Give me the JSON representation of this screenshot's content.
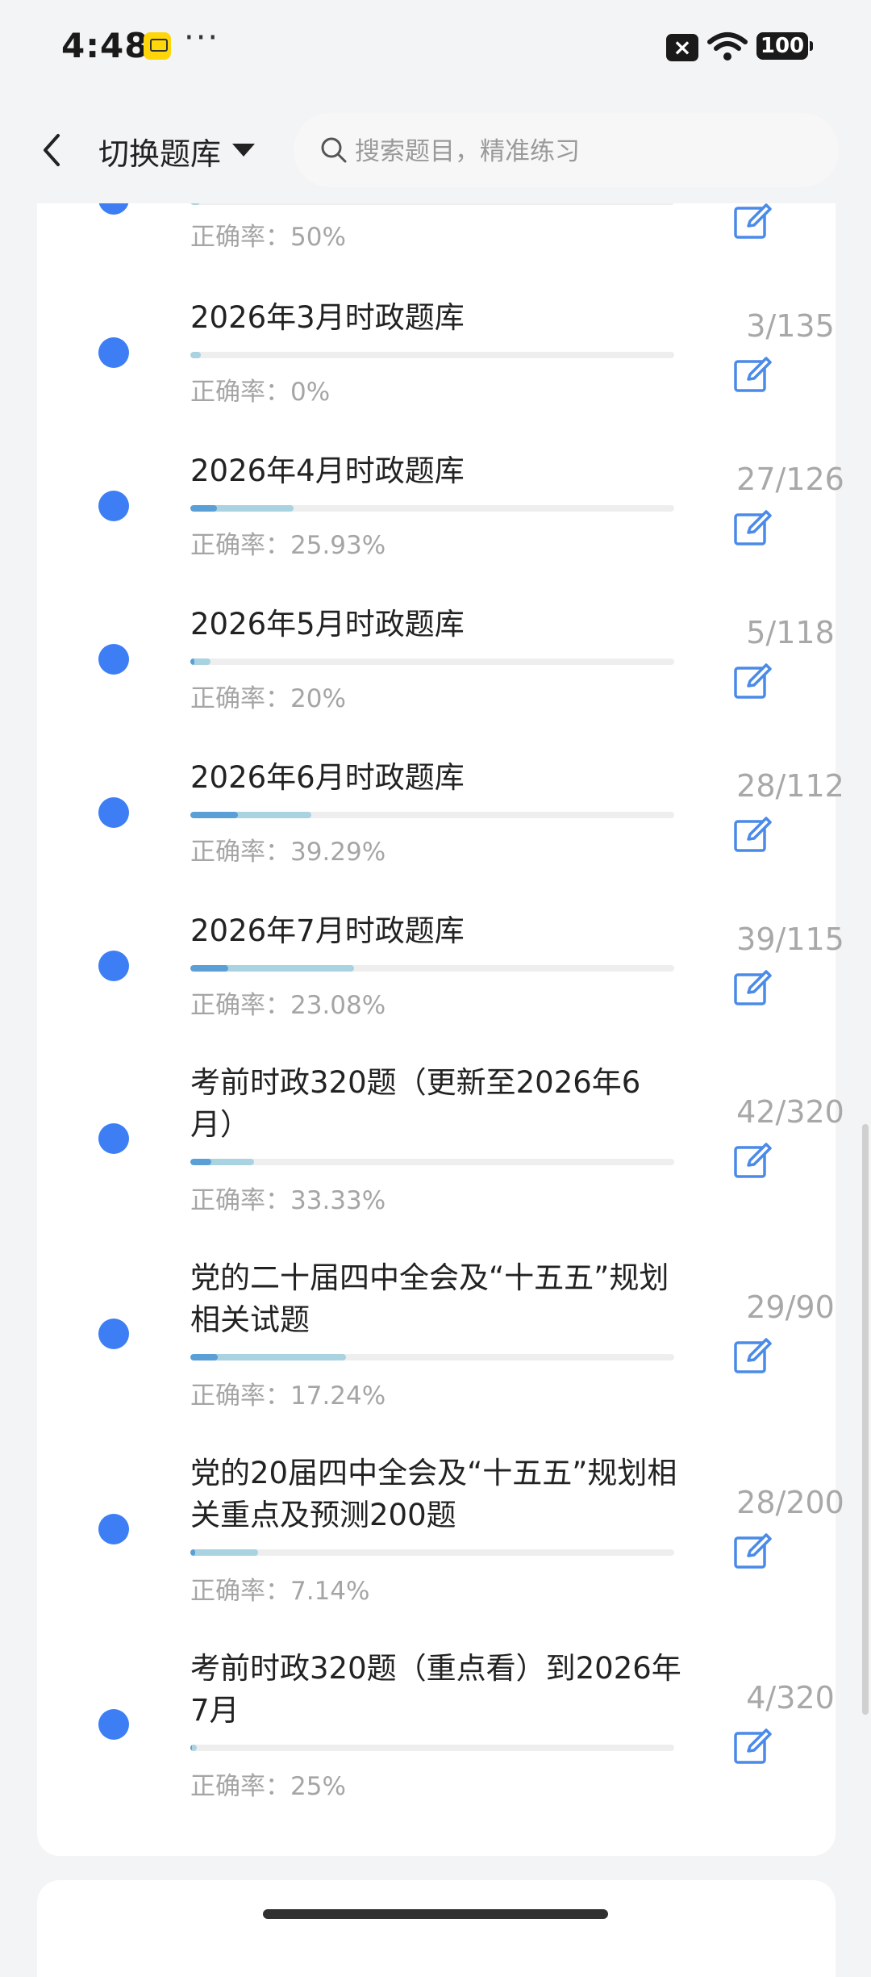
{
  "status_bar": {
    "time": "4:48",
    "more": "···",
    "sim": "×",
    "battery": "100"
  },
  "header": {
    "title": "切换题库",
    "search_placeholder": "搜索题目，精准练习"
  },
  "accuracy_label": "正确率：",
  "rows": [
    {
      "name": "",
      "accuracy": "50%",
      "progress": "",
      "fill": 0.02,
      "correct_fill": 0.0
    },
    {
      "name": "2026年3月时政题库",
      "accuracy": "0%",
      "progress": "3/135",
      "fill": 0.0222,
      "correct_fill": 0.0
    },
    {
      "name": "2026年4月时政题库",
      "accuracy": "25.93%",
      "progress": "27/126",
      "fill": 0.214,
      "correct_fill": 0.0555
    },
    {
      "name": "2026年5月时政题库",
      "accuracy": "20%",
      "progress": "5/118",
      "fill": 0.042,
      "correct_fill": 0.0085
    },
    {
      "name": "2026年6月时政题库",
      "accuracy": "39.29%",
      "progress": "28/112",
      "fill": 0.25,
      "correct_fill": 0.098
    },
    {
      "name": "2026年7月时政题库",
      "accuracy": "23.08%",
      "progress": "39/115",
      "fill": 0.339,
      "correct_fill": 0.078
    },
    {
      "name": "考前时政320题（更新至2026年6月）",
      "accuracy": "33.33%",
      "progress": "42/320",
      "fill": 0.131,
      "correct_fill": 0.044
    },
    {
      "name": "党的二十届四中全会及“十五五”规划相关试题",
      "accuracy": "17.24%",
      "progress": "29/90",
      "fill": 0.322,
      "correct_fill": 0.056
    },
    {
      "name": "党的20届四中全会及“十五五”规划相关重点及预测200题",
      "accuracy": "7.14%",
      "progress": "28/200",
      "fill": 0.14,
      "correct_fill": 0.01
    },
    {
      "name": "考前时政320题（重点看）到2026年7月",
      "accuracy": "25%",
      "progress": "4/320",
      "fill": 0.0125,
      "correct_fill": 0.003
    }
  ]
}
